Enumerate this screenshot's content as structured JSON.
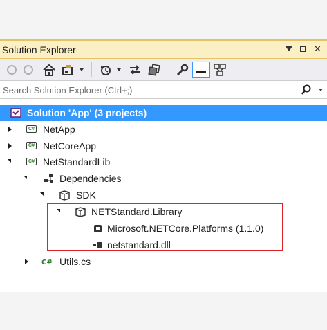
{
  "window": {
    "title": "Solution Explorer",
    "controls": {
      "pin": "pin-icon",
      "maximize": "maximize-icon",
      "close": "close-icon"
    }
  },
  "toolbar": {
    "buttons": [
      "back-icon",
      "forward-icon",
      "home-icon",
      "switch-views-icon",
      "dropdown-icon",
      "pending-changes-icon",
      "dropdown-icon",
      "sync-icon",
      "collapse-all-icon",
      "properties-icon",
      "preview-icon",
      "view-class-diagram-icon"
    ]
  },
  "search": {
    "placeholder": "Search Solution Explorer (Ctrl+;)"
  },
  "tree": {
    "solution": "Solution 'App' (3 projects)",
    "items": [
      {
        "label": "NetApp",
        "icon": "csharp-project-icon",
        "expanded": false
      },
      {
        "label": "NetCoreApp",
        "icon": "csharp-project-icon",
        "expanded": false
      },
      {
        "label": "NetStandardLib",
        "icon": "csharp-project-icon",
        "expanded": true
      },
      {
        "label": "Dependencies",
        "icon": "dependencies-icon",
        "expanded": true
      },
      {
        "label": "SDK",
        "icon": "package-icon",
        "expanded": true
      },
      {
        "label": "NETStandard.Library",
        "icon": "package-icon",
        "expanded": true
      },
      {
        "label": "Microsoft.NETCore.Platforms (1.1.0)",
        "icon": "package-ref-icon"
      },
      {
        "label": "netstandard.dll",
        "icon": "assembly-icon"
      },
      {
        "label": "Utils.cs",
        "icon": "csharp-file-icon",
        "expanded": false
      }
    ]
  },
  "colors": {
    "selection": "#3399ff",
    "title_bar": "#fbf0c3",
    "highlight_border": "#d9252a"
  }
}
